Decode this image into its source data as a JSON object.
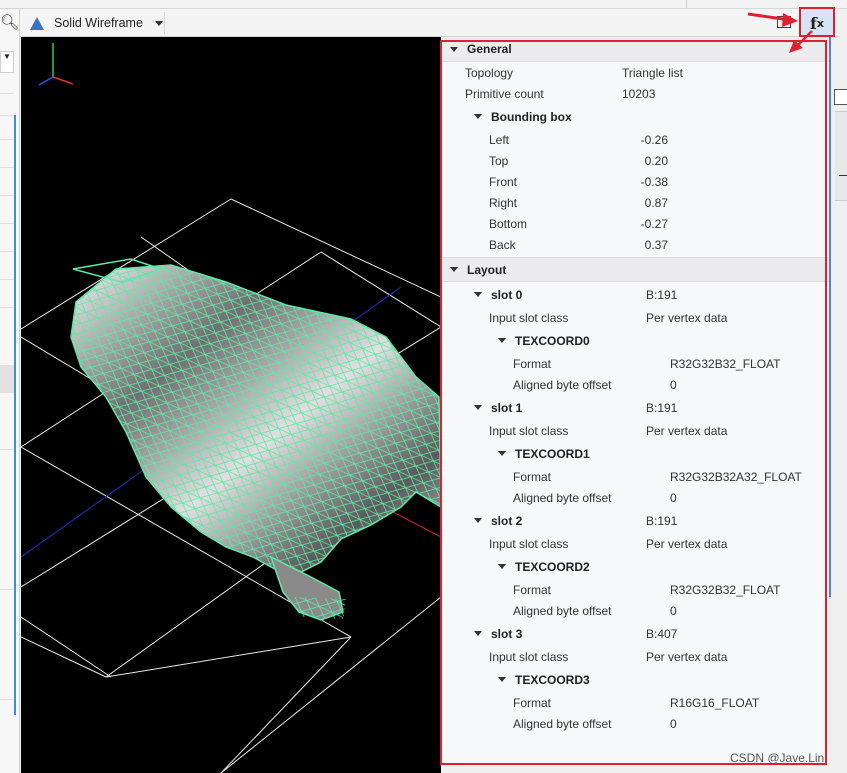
{
  "toolbar": {
    "mode_label": "Solid Wireframe",
    "fx_main": "f",
    "fx_sub": "x"
  },
  "icons": {
    "mode": "solid-wireframe-icon",
    "fx": "fx-icon",
    "search": "search-icon"
  },
  "colors": {
    "accent": "#3578c8",
    "highlight_red": "#e02030",
    "mesh_green": "#5ee8a8",
    "viewport_bg": "#000000"
  },
  "general": {
    "title": "General",
    "topology_label": "Topology",
    "topology_value": "Triangle list",
    "primitive_label": "Primitive count",
    "primitive_value": "10203",
    "bbox": {
      "title": "Bounding box",
      "rows": [
        {
          "label": "Left",
          "value": "-0.26"
        },
        {
          "label": "Top",
          "value": "0.20"
        },
        {
          "label": "Front",
          "value": "-0.38"
        },
        {
          "label": "Right",
          "value": "0.87"
        },
        {
          "label": "Bottom",
          "value": "-0.27"
        },
        {
          "label": "Back",
          "value": "0.37"
        }
      ]
    }
  },
  "layout": {
    "title": "Layout",
    "slots": [
      {
        "name": "slot 0",
        "stride": "B:191",
        "class_label": "Input slot class",
        "class_value": "Per vertex data",
        "attr": "TEXCOORD0",
        "format_label": "Format",
        "format_value": "R32G32B32_FLOAT",
        "offset_label": "Aligned byte offset",
        "offset_value": "0"
      },
      {
        "name": "slot 1",
        "stride": "B:191",
        "class_label": "Input slot class",
        "class_value": "Per vertex data",
        "attr": "TEXCOORD1",
        "format_label": "Format",
        "format_value": "R32G32B32A32_FLOAT",
        "offset_label": "Aligned byte offset",
        "offset_value": "0"
      },
      {
        "name": "slot 2",
        "stride": "B:191",
        "class_label": "Input slot class",
        "class_value": "Per vertex data",
        "attr": "TEXCOORD2",
        "format_label": "Format",
        "format_value": "R32G32B32_FLOAT",
        "offset_label": "Aligned byte offset",
        "offset_value": "0"
      },
      {
        "name": "slot 3",
        "stride": "B:407",
        "class_label": "Input slot class",
        "class_value": "Per vertex data",
        "attr": "TEXCOORD3",
        "format_label": "Format",
        "format_value": "R16G16_FLOAT",
        "offset_label": "Aligned byte offset",
        "offset_value": "0"
      }
    ]
  },
  "watermark": "CSDN @Jave.Lin"
}
